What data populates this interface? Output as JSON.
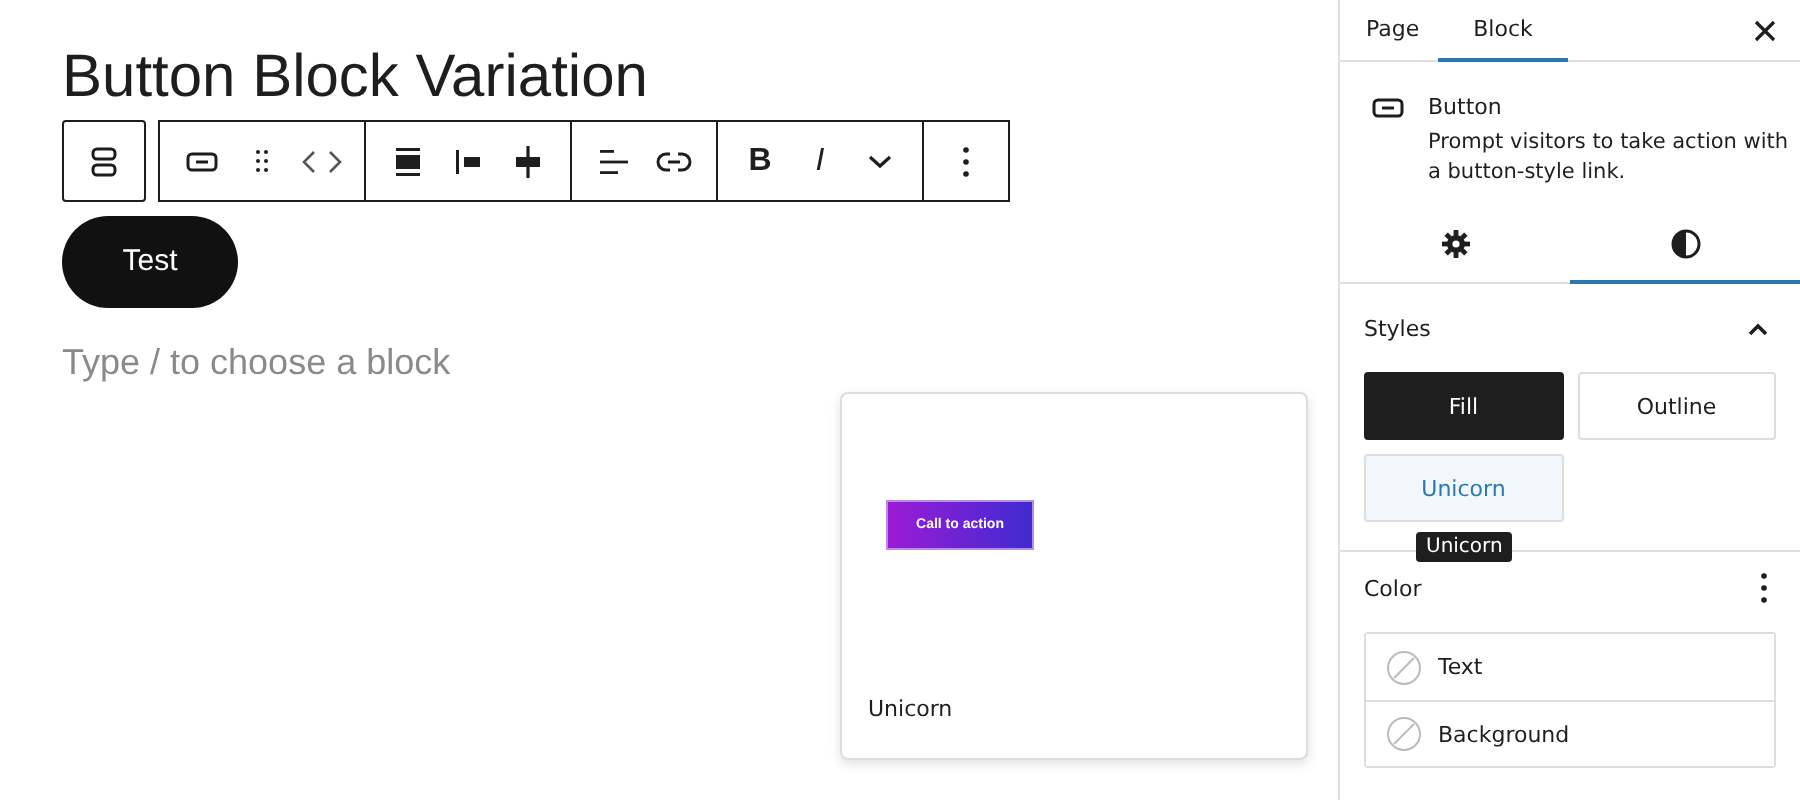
{
  "editor": {
    "heading": "Button Block Variation",
    "toolbar": {
      "bold": "B",
      "italic": "I"
    },
    "button_text": "Test",
    "placeholder": "Type / to choose a block"
  },
  "preview_popover": {
    "button_text": "Call to action",
    "label": "Unicorn"
  },
  "sidebar": {
    "tabs": [
      {
        "label": "Page",
        "selected": false
      },
      {
        "label": "Block",
        "selected": true
      }
    ],
    "block": {
      "title": "Button",
      "description": "Prompt visitors to take action with a button-style link."
    },
    "panel_tabs": [
      {
        "kind": "settings",
        "selected": false
      },
      {
        "kind": "styles",
        "selected": true
      }
    ],
    "styles": {
      "title": "Styles",
      "expanded": true,
      "options": [
        {
          "label": "Fill",
          "selected": true,
          "hovered": false
        },
        {
          "label": "Outline",
          "selected": false,
          "hovered": false
        },
        {
          "label": "Unicorn",
          "selected": false,
          "hovered": true
        }
      ],
      "tooltip": "Unicorn"
    },
    "color": {
      "title": "Color",
      "items": [
        {
          "label": "Text"
        },
        {
          "label": "Background"
        }
      ]
    }
  }
}
